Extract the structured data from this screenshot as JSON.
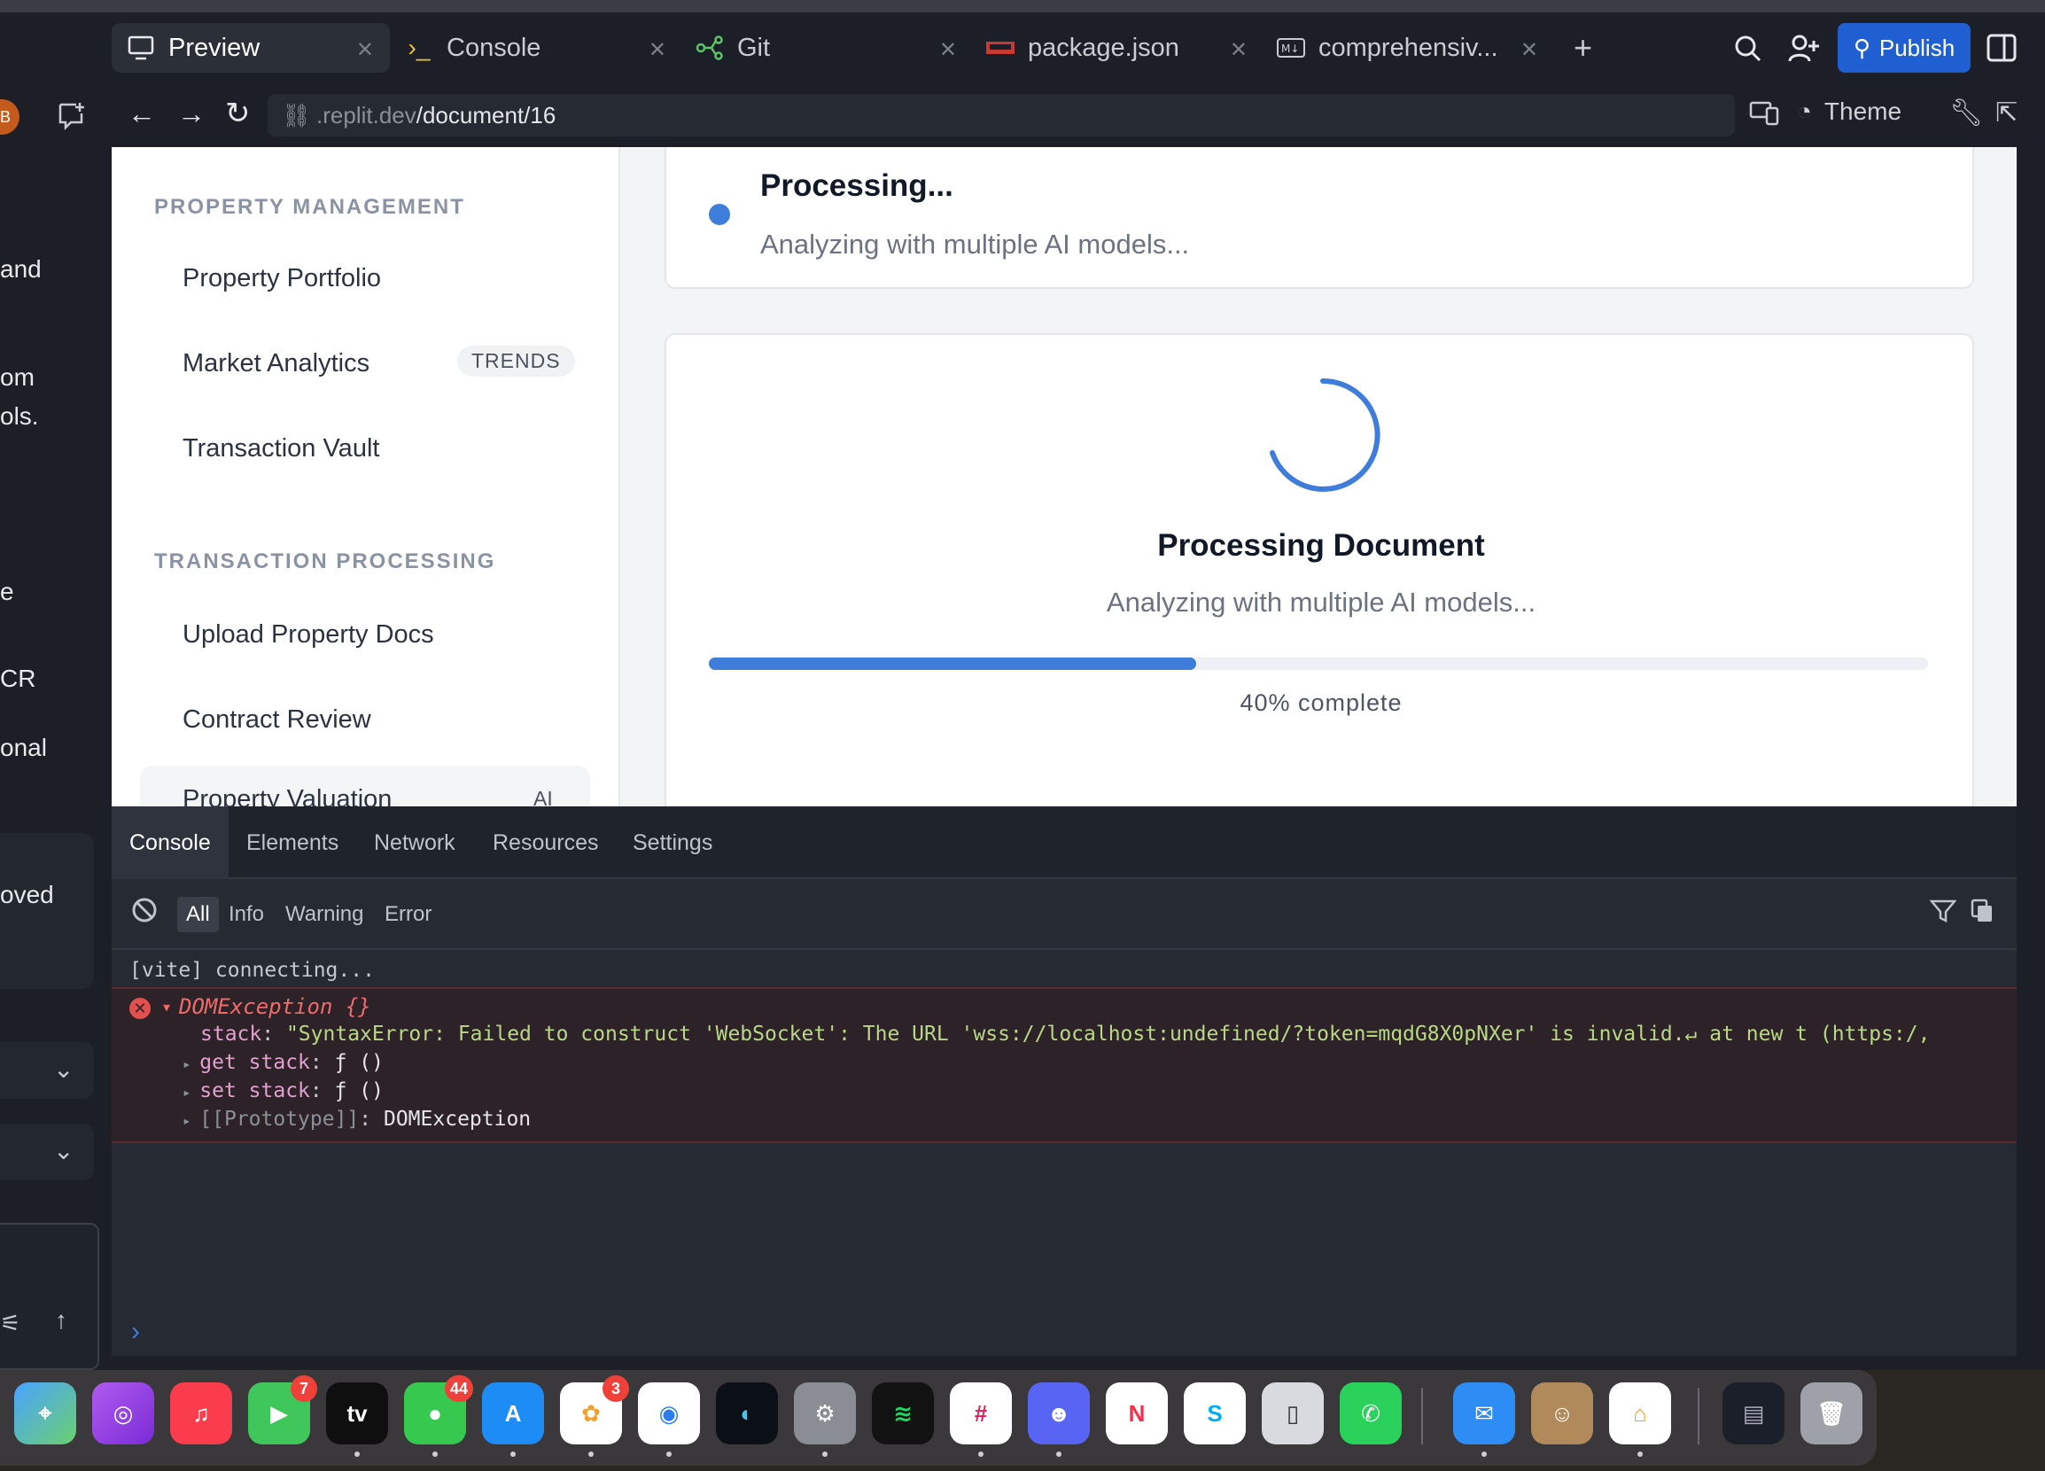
{
  "tabs": [
    {
      "label": "Preview",
      "icon": "monitor-icon"
    },
    {
      "label": "Console",
      "icon": "terminal-icon"
    },
    {
      "label": "Git",
      "icon": "git-icon"
    },
    {
      "label": "package.json",
      "icon": "npm-icon"
    },
    {
      "label": "comprehensiv...",
      "icon": "markdown-icon"
    }
  ],
  "toolbar": {
    "publish_label": "Publish",
    "theme_label": "Theme"
  },
  "url": {
    "prefix": ".replit.dev",
    "path": "/document/16"
  },
  "left_strip": {
    "snippets": [
      "and",
      "om",
      "ols.",
      "e",
      "CR",
      "onal",
      "oved"
    ],
    "avatar_letter": "B"
  },
  "sidebar": {
    "sections": [
      {
        "heading": "PROPERTY MANAGEMENT",
        "items": [
          "Property Portfolio",
          "Market Analytics",
          "Transaction Vault"
        ]
      },
      {
        "heading": "TRANSACTION PROCESSING",
        "items": [
          "Upload Property Docs",
          "Contract Review",
          "Property Valuation"
        ]
      }
    ],
    "badges": {
      "market_analytics": "TRENDS",
      "property_valuation": "AI"
    }
  },
  "status_card": {
    "title": "Processing...",
    "subtitle": "Analyzing with multiple AI models..."
  },
  "processing_card": {
    "title": "Processing Document",
    "subtitle": "Analyzing with multiple AI models...",
    "progress": 0.4,
    "progress_label": "40% complete"
  },
  "devtools": {
    "tabs": [
      "Console",
      "Elements",
      "Network",
      "Resources",
      "Settings"
    ],
    "filters": [
      "All",
      "Info",
      "Warning",
      "Error"
    ],
    "log": "[vite] connecting...",
    "error": {
      "name": "DOMException {}",
      "stack_key": "stack",
      "stack_value": "\"SyntaxError: Failed to construct 'WebSocket': The URL 'wss://localhost:undefined/?token=mqdG8X0pNXer' is invalid.↵ at new t (https:/,",
      "get_stack": "get stack",
      "set_stack": "set stack",
      "fn": "ƒ ()",
      "proto_key": "[[Prototype]]",
      "proto_val": "DOMException"
    }
  },
  "dock": {
    "apps": [
      "Maps",
      "Podcasts",
      "Music",
      "FaceTime",
      "TV",
      "Messages",
      "App Store",
      "Photos",
      "Chrome",
      "Elytra",
      "System Settings",
      "Spotify",
      "Slack",
      "Discord",
      "News",
      "Skype",
      "iPhone Mirroring",
      "WhatsApp",
      "Mail",
      "Contacts",
      "Home",
      "Finder Window",
      "Trash"
    ],
    "tv_label": "tv",
    "badges": {
      "facetime": "7",
      "messages": "44",
      "photos": "3"
    }
  },
  "colors": {
    "accent": "#3f7ddb",
    "publish": "#1f5fd1",
    "error": "#ef6b6b"
  }
}
